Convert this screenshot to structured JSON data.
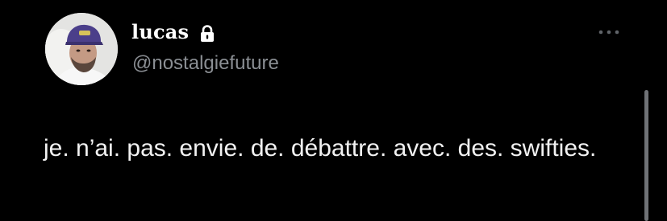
{
  "author": {
    "display_name": "lucas",
    "handle": "@nostalgiefuture",
    "protected_icon": "lock-icon",
    "avatar_icon": "profile-photo"
  },
  "tweet": {
    "text": "je. n’ai. pas. envie. de. débattre. avec. des. swifties."
  },
  "menu": {
    "more_icon": "more-options-icon"
  },
  "colors": {
    "background": "#000000",
    "primary_text": "#e7e9ea",
    "secondary_text": "#8b8f94"
  }
}
